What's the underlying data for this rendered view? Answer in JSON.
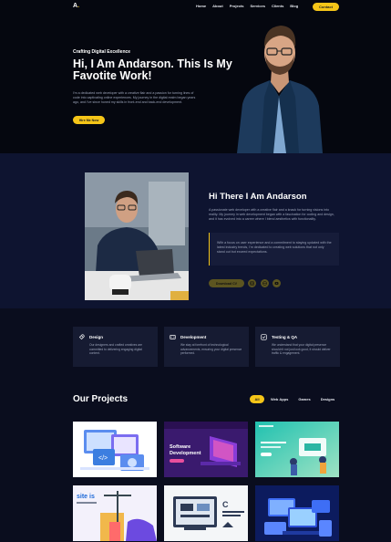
{
  "nav": {
    "logo": "A",
    "logo_dot": ".",
    "links": [
      "Home",
      "About",
      "Projects",
      "Services",
      "Clients",
      "Blog"
    ],
    "contact": "Contact"
  },
  "hero": {
    "eyebrow": "Crafting Digital Excellence",
    "title": "Hi, I Am Andarson. This Is My Favotite Work!",
    "description": "I'm a dedicated web developer with a creative flair and a passion for turning lines of code into captivating online experiences. My journey in the digital realm began years ago, and I've since honed my skills in front-end and back-end development.",
    "cta": "Hire Me Now"
  },
  "about": {
    "title": "Hi There I Am Andarson",
    "description": "A passionate web developer with a creative flair and a knack for turning visions into reality. My journey in web development began with a fascination for coding and design, and it has evolved into a career where I blend aesthetics with functionality.",
    "quote": "With a focus on user experience and a commitment to staying updated with the latest industry trends, I'm dedicated to creating web solutions that not only stand out but exceed expectations.",
    "download": "Download CV",
    "social_icons": [
      "instagram-icon",
      "globe-icon",
      "youtube-icon"
    ]
  },
  "services": [
    {
      "icon": "rocket-icon",
      "title": "Design",
      "text": "Our designers and crafted creatives are committed to delivering engaging digital content."
    },
    {
      "icon": "code-icon",
      "title": "Development",
      "text": "We stay at forefront of technological advancements, ensuring your digital presence performed."
    },
    {
      "icon": "check-icon",
      "title": "Testing & QA",
      "text": "We understand that your digital presence shouldn't not just look good, it should deliver traffic & engagement."
    }
  ],
  "projects": {
    "title": "Our Projects",
    "filters": [
      "All",
      "Web Apps",
      "Games",
      "Designs"
    ],
    "card_texts": {
      "software": "Software",
      "development": "Development"
    }
  },
  "colors": {
    "accent": "#f5c518",
    "background": "#0a0d1e",
    "about_bg": "#0e1430",
    "card_bg": "#161b32"
  }
}
